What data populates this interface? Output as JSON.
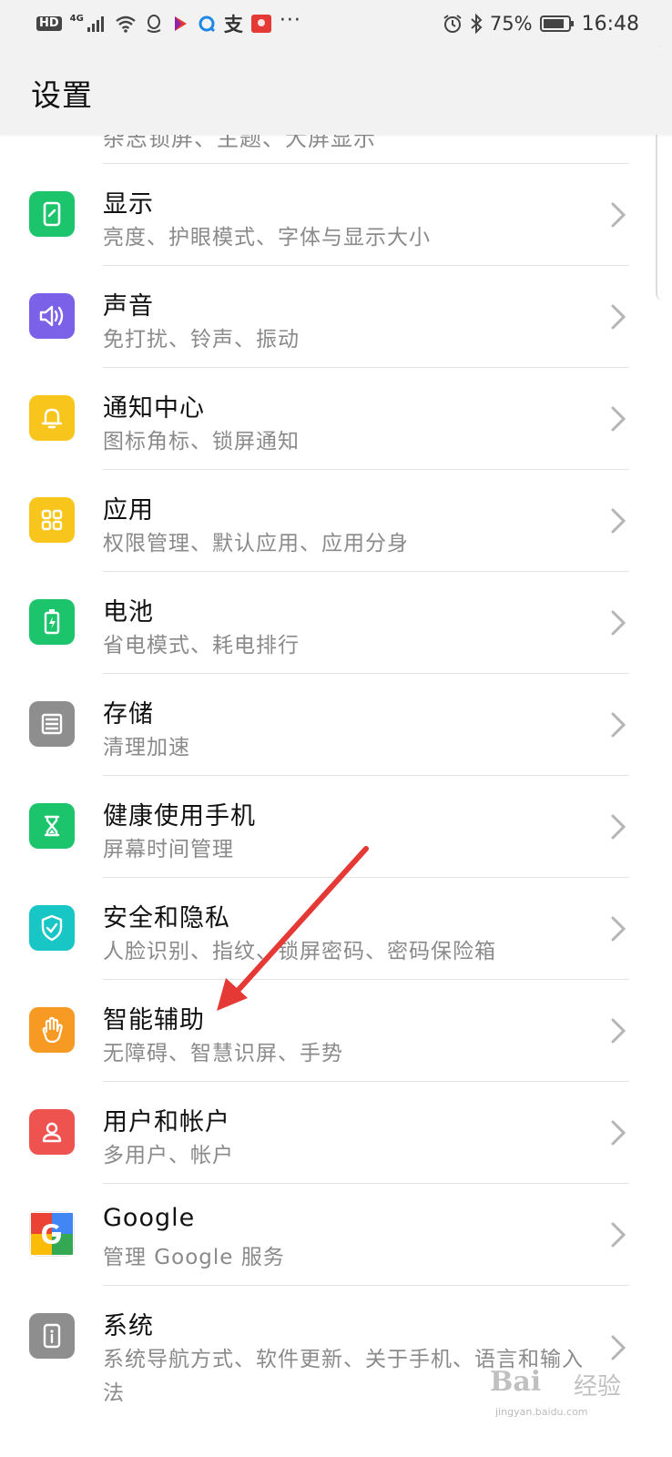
{
  "status_bar": {
    "hd": "HD",
    "network": "4G",
    "zhi": "支",
    "more": "···",
    "battery": "75%",
    "time": "16:48"
  },
  "header": {
    "title": "设置"
  },
  "partial_item": {
    "subtitle": "杂志锁屏、主题、大屏显示"
  },
  "items": [
    {
      "title": "显示",
      "subtitle": "亮度、护眼模式、字体与显示大小",
      "icon": "display-icon",
      "color": "#1cc46b"
    },
    {
      "title": "声音",
      "subtitle": "免打扰、铃声、振动",
      "icon": "sound-icon",
      "color": "#7b61e8"
    },
    {
      "title": "通知中心",
      "subtitle": "图标角标、锁屏通知",
      "icon": "bell-icon",
      "color": "#f8c51c"
    },
    {
      "title": "应用",
      "subtitle": "权限管理、默认应用、应用分身",
      "icon": "apps-icon",
      "color": "#f8c51c"
    },
    {
      "title": "电池",
      "subtitle": "省电模式、耗电排行",
      "icon": "battery-icon",
      "color": "#1cc46b"
    },
    {
      "title": "存储",
      "subtitle": "清理加速",
      "icon": "storage-icon",
      "color": "#8e8e8e"
    },
    {
      "title": "健康使用手机",
      "subtitle": "屏幕时间管理",
      "icon": "hourglass-icon",
      "color": "#1cc46b"
    },
    {
      "title": "安全和隐私",
      "subtitle": "人脸识别、指纹、锁屏密码、密码保险箱",
      "icon": "shield-icon",
      "color": "#19c6c6"
    },
    {
      "title": "智能辅助",
      "subtitle": "无障碍、智慧识屏、手势",
      "icon": "hand-icon",
      "color": "#f79a23"
    },
    {
      "title": "用户和帐户",
      "subtitle": "多用户、帐户",
      "icon": "user-icon",
      "color": "#ef5350"
    },
    {
      "title": "Google",
      "subtitle": "管理 Google 服务",
      "icon": "google-icon",
      "color": "#ffffff"
    },
    {
      "title": "系统",
      "subtitle": "系统导航方式、软件更新、关于手机、语言和输入法",
      "icon": "system-icon",
      "color": "#8e8e8e"
    }
  ],
  "watermark": {
    "logo": "Bai",
    "cn": "经验",
    "url": "jingyan.baidu.com"
  },
  "colors": {
    "accent_arrow": "#e53935",
    "background": "#ffffff",
    "header": "#f2f2f2"
  }
}
